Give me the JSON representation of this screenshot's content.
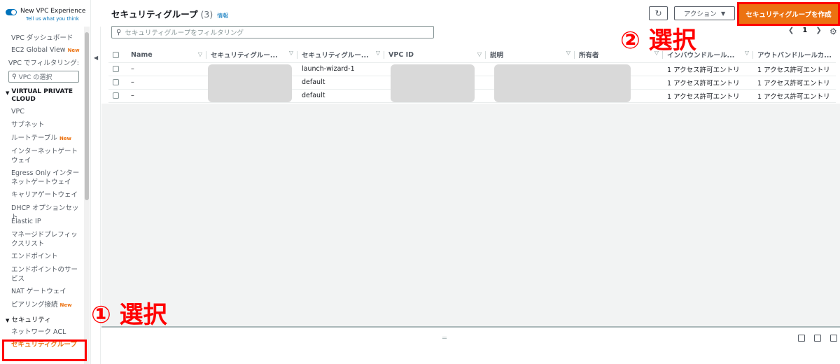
{
  "sidebar": {
    "toggle_title": "New VPC Experience",
    "toggle_sub": "Tell us what you think",
    "items_top": [
      {
        "label": "VPC ダッシュボード",
        "badge": ""
      },
      {
        "label": "EC2 Global View",
        "badge": "New"
      }
    ],
    "filter_label": "VPC でフィルタリング:",
    "vpc_select_placeholder": "VPC の選択",
    "section_vpc": "VIRTUAL PRIVATE CLOUD",
    "items_vpc": [
      {
        "label": "VPC",
        "badge": ""
      },
      {
        "label": "サブネット",
        "badge": ""
      },
      {
        "label": "ルートテーブル",
        "badge": "New"
      },
      {
        "label": "インターネットゲートウェイ",
        "badge": ""
      },
      {
        "label": "Egress Only インターネットゲートウェイ",
        "badge": ""
      },
      {
        "label": "キャリアゲートウェイ",
        "badge": ""
      },
      {
        "label": "DHCP オプションセット",
        "badge": ""
      },
      {
        "label": "Elastic IP",
        "badge": ""
      },
      {
        "label": "マネージドプレフィックスリスト",
        "badge": ""
      },
      {
        "label": "エンドポイント",
        "badge": ""
      },
      {
        "label": "エンドポイントのサービス",
        "badge": ""
      },
      {
        "label": "NAT ゲートウェイ",
        "badge": ""
      },
      {
        "label": "ピアリング接続",
        "badge": "New"
      }
    ],
    "section_security": "セキュリティ",
    "items_security": [
      {
        "label": "ネットワーク ACL"
      },
      {
        "label": "セキュリティグループ"
      }
    ]
  },
  "header": {
    "title": "セキュリティグループ",
    "count": "(3)",
    "info": "情報",
    "action_label": "アクション",
    "create_label": "セキュリティグループを作成",
    "search_placeholder": "セキュリティグループをフィルタリング",
    "page": "1"
  },
  "table": {
    "columns": [
      "Name",
      "セキュリティグルー...",
      "セキュリティグルー...",
      "VPC ID",
      "説明",
      "所有者",
      "インバウンドルール...",
      "アウトバンドルールカ..."
    ],
    "rows": [
      [
        "–",
        "",
        "launch-wizard-1",
        "",
        "",
        "",
        "1 アクセス許可エントリ",
        "1 アクセス許可エントリ"
      ],
      [
        "–",
        "",
        "default",
        "",
        "",
        "",
        "1 アクセス許可エントリ",
        "1 アクセス許可エントリ"
      ],
      [
        "–",
        "",
        "default",
        "",
        "",
        "",
        "1 アクセス許可エントリ",
        "1 アクセス許可エントリ"
      ]
    ]
  },
  "annotations": {
    "step1": "① 選択",
    "step2": "② 選択"
  },
  "colors": {
    "accent": "#ec7211",
    "link": "#0073bb",
    "annotation": "#ff0000"
  }
}
